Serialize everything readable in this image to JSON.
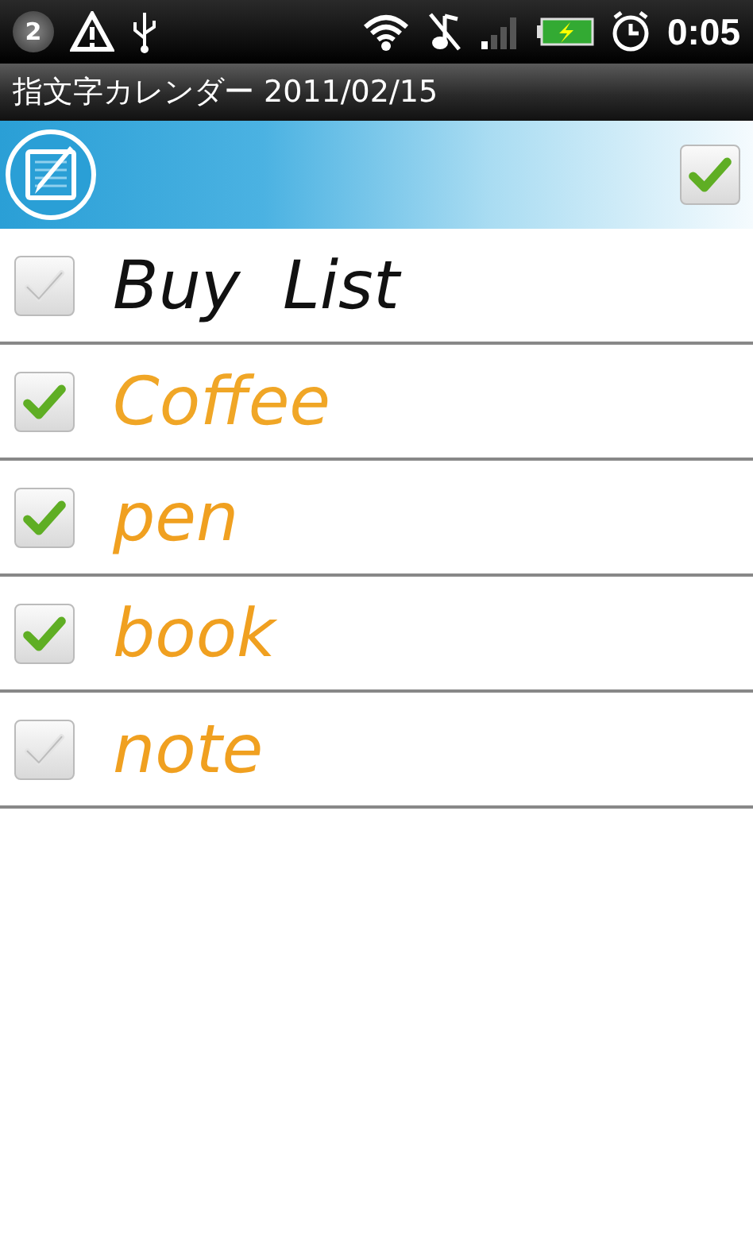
{
  "status_bar": {
    "time": "0:05",
    "notification_count": "2"
  },
  "title_bar": {
    "title": "指文字カレンダー 2011/02/15"
  },
  "toolbar": {
    "check_all": {
      "checked": true
    }
  },
  "items": [
    {
      "text": "Buy  List",
      "checked": false,
      "color": "#111111"
    },
    {
      "text": "Coffee",
      "checked": true,
      "color": "#f0a626"
    },
    {
      "text": "pen",
      "checked": true,
      "color": "#f0a020"
    },
    {
      "text": "book",
      "checked": true,
      "color": "#f0a020"
    },
    {
      "text": "note",
      "checked": false,
      "color": "#f0a020"
    }
  ]
}
